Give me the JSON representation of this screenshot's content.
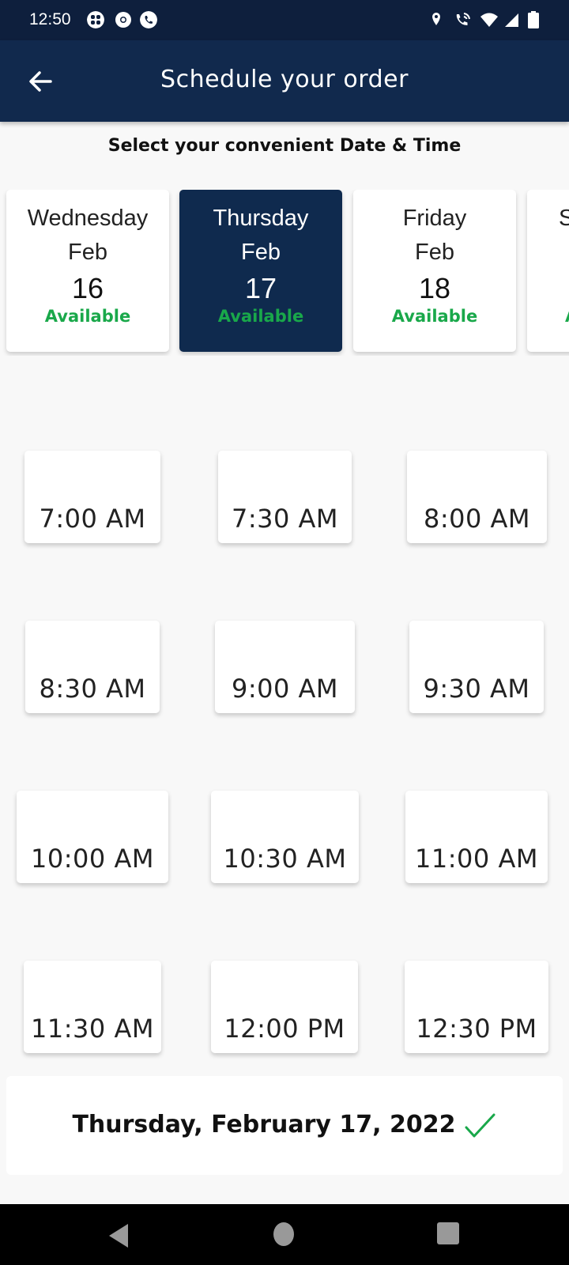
{
  "status_bar": {
    "time": "12:50",
    "left_icons": [
      "grid-app-icon",
      "chrome-icon",
      "phone-app-icon"
    ],
    "right_icons": [
      "location-icon",
      "wifi-calling-icon",
      "wifi-icon",
      "signal-icon",
      "battery-icon"
    ]
  },
  "app_bar": {
    "back_icon": "arrow-left-icon",
    "title": "Schedule your order"
  },
  "subtitle": "Select your convenient Date & Time",
  "dates": [
    {
      "day": "Wednesday",
      "month": "Feb",
      "date": "16",
      "status": "Available",
      "selected": false
    },
    {
      "day": "Thursday",
      "month": "Feb",
      "date": "17",
      "status": "Available",
      "selected": true
    },
    {
      "day": "Friday",
      "month": "Feb",
      "date": "18",
      "status": "Available",
      "selected": false
    },
    {
      "day": "S",
      "month": "",
      "date": "",
      "status": "A",
      "selected": false
    }
  ],
  "time_slots": [
    "7:00 AM",
    "7:30 AM",
    "8:00 AM",
    "8:30 AM",
    "9:00 AM",
    "9:30 AM",
    "10:00 AM",
    "10:30 AM",
    "11:00 AM",
    "11:30 AM",
    "12:00 PM",
    "12:30 PM"
  ],
  "summary": {
    "selected_text": "Thursday, February 17, 2022",
    "icon": "check-icon"
  },
  "colors": {
    "primary": "#11294d",
    "status_bar": "#0e1f3d",
    "available": "#19a84a",
    "background": "#f8f8f8"
  },
  "nav_bar": [
    "back-nav-icon",
    "home-nav-icon",
    "recents-nav-icon"
  ]
}
